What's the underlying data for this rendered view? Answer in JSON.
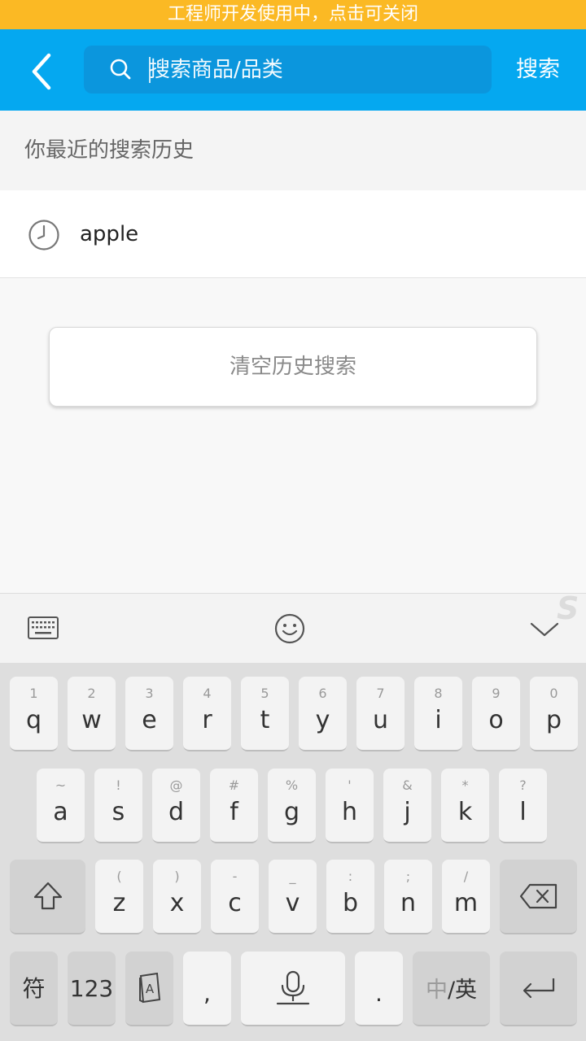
{
  "dev_banner": "工程师开发使用中，点击可关闭",
  "header": {
    "search_placeholder": "搜索商品/品类",
    "search_action": "搜索"
  },
  "history": {
    "title": "你最近的搜索历史",
    "items": [
      "apple"
    ],
    "clear_label": "清空历史搜索"
  },
  "keyboard": {
    "row1": [
      {
        "num": "1",
        "ch": "q"
      },
      {
        "num": "2",
        "ch": "w"
      },
      {
        "num": "3",
        "ch": "e"
      },
      {
        "num": "4",
        "ch": "r"
      },
      {
        "num": "5",
        "ch": "t"
      },
      {
        "num": "6",
        "ch": "y"
      },
      {
        "num": "7",
        "ch": "u"
      },
      {
        "num": "8",
        "ch": "i"
      },
      {
        "num": "9",
        "ch": "o"
      },
      {
        "num": "0",
        "ch": "p"
      }
    ],
    "row2": [
      {
        "num": "~",
        "ch": "a"
      },
      {
        "num": "!",
        "ch": "s"
      },
      {
        "num": "@",
        "ch": "d"
      },
      {
        "num": "#",
        "ch": "f"
      },
      {
        "num": "%",
        "ch": "g"
      },
      {
        "num": "'",
        "ch": "h"
      },
      {
        "num": "&",
        "ch": "j"
      },
      {
        "num": "*",
        "ch": "k"
      },
      {
        "num": "?",
        "ch": "l"
      }
    ],
    "row3": [
      {
        "num": "(",
        "ch": "z"
      },
      {
        "num": ")",
        "ch": "x"
      },
      {
        "num": "-",
        "ch": "c"
      },
      {
        "num": "_",
        "ch": "v"
      },
      {
        "num": ":",
        "ch": "b"
      },
      {
        "num": ";",
        "ch": "n"
      },
      {
        "num": "/",
        "ch": "m"
      }
    ],
    "symbol_key": "符",
    "numeric_key": "123",
    "comma_key": ",",
    "period_key": ".",
    "lang_key_cn": "中",
    "lang_key_sep": "/",
    "lang_key_en": "英"
  },
  "colors": {
    "accent": "#05a8f0",
    "banner": "#fbb924"
  },
  "icons": {
    "back": "chevron-left-icon",
    "search": "search-icon",
    "history": "clock-icon",
    "keyboard": "keyboard-icon",
    "emoji": "smiley-icon",
    "collapse": "chevron-down-icon",
    "shift": "shift-icon",
    "backspace": "backspace-icon",
    "handwriting": "handwriting-icon",
    "voice": "microphone-icon",
    "enter": "enter-icon"
  }
}
